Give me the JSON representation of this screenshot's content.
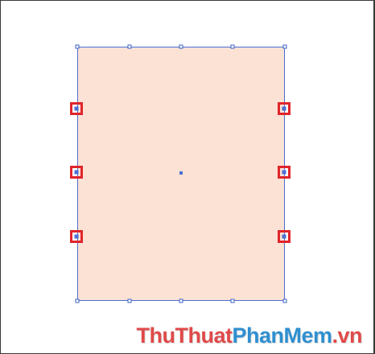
{
  "colors": {
    "shape_fill": "#fbe2d4",
    "selection_blue": "#4a6fd4",
    "highlight_red": "#e0252b",
    "watermark_red": "#e04a4a",
    "watermark_blue": "#2f8fd0"
  },
  "watermark": {
    "part1": "ThuThuat",
    "part2": "PhanMem",
    "part3": ".vn"
  }
}
